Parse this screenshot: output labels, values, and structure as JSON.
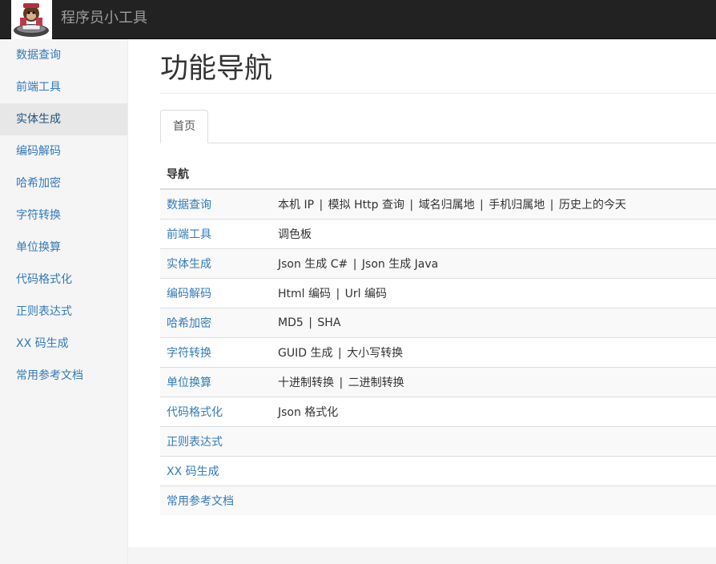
{
  "navbar": {
    "brand": "程序员小工具"
  },
  "sidebar": {
    "items": [
      {
        "label": "数据查询",
        "active": false
      },
      {
        "label": "前端工具",
        "active": false
      },
      {
        "label": "实体生成",
        "active": true
      },
      {
        "label": "编码解码",
        "active": false
      },
      {
        "label": "哈希加密",
        "active": false
      },
      {
        "label": "字符转换",
        "active": false
      },
      {
        "label": "单位换算",
        "active": false
      },
      {
        "label": "代码格式化",
        "active": false
      },
      {
        "label": "正则表达式",
        "active": false
      },
      {
        "label": "XX 码生成",
        "active": false
      },
      {
        "label": "常用参考文档",
        "active": false
      }
    ]
  },
  "main": {
    "title": "功能导航",
    "tabs": [
      {
        "label": "首页"
      }
    ],
    "table": {
      "header": "导航",
      "rows": [
        {
          "category": "数据查询",
          "links": [
            "本机 IP",
            "模拟 Http 查询",
            "域名归属地",
            "手机归属地",
            "历史上的今天"
          ]
        },
        {
          "category": "前端工具",
          "links": [
            "调色板"
          ]
        },
        {
          "category": "实体生成",
          "links": [
            "Json 生成 C#",
            "Json 生成 Java"
          ]
        },
        {
          "category": "编码解码",
          "links": [
            "Html 编码",
            "Url 编码"
          ]
        },
        {
          "category": "哈希加密",
          "links": [
            "MD5",
            "SHA"
          ]
        },
        {
          "category": "字符转换",
          "links": [
            "GUID 生成",
            "大小写转换"
          ]
        },
        {
          "category": "单位换算",
          "links": [
            "十进制转换",
            "二进制转换"
          ]
        },
        {
          "category": "代码格式化",
          "links": [
            "Json 格式化"
          ]
        },
        {
          "category": "正则表达式",
          "links": []
        },
        {
          "category": "XX 码生成",
          "links": []
        },
        {
          "category": "常用参考文档",
          "links": []
        }
      ]
    }
  },
  "colors": {
    "navbar": "#222222",
    "link": "#337ab7",
    "active_bg": "#e7e7e7"
  }
}
